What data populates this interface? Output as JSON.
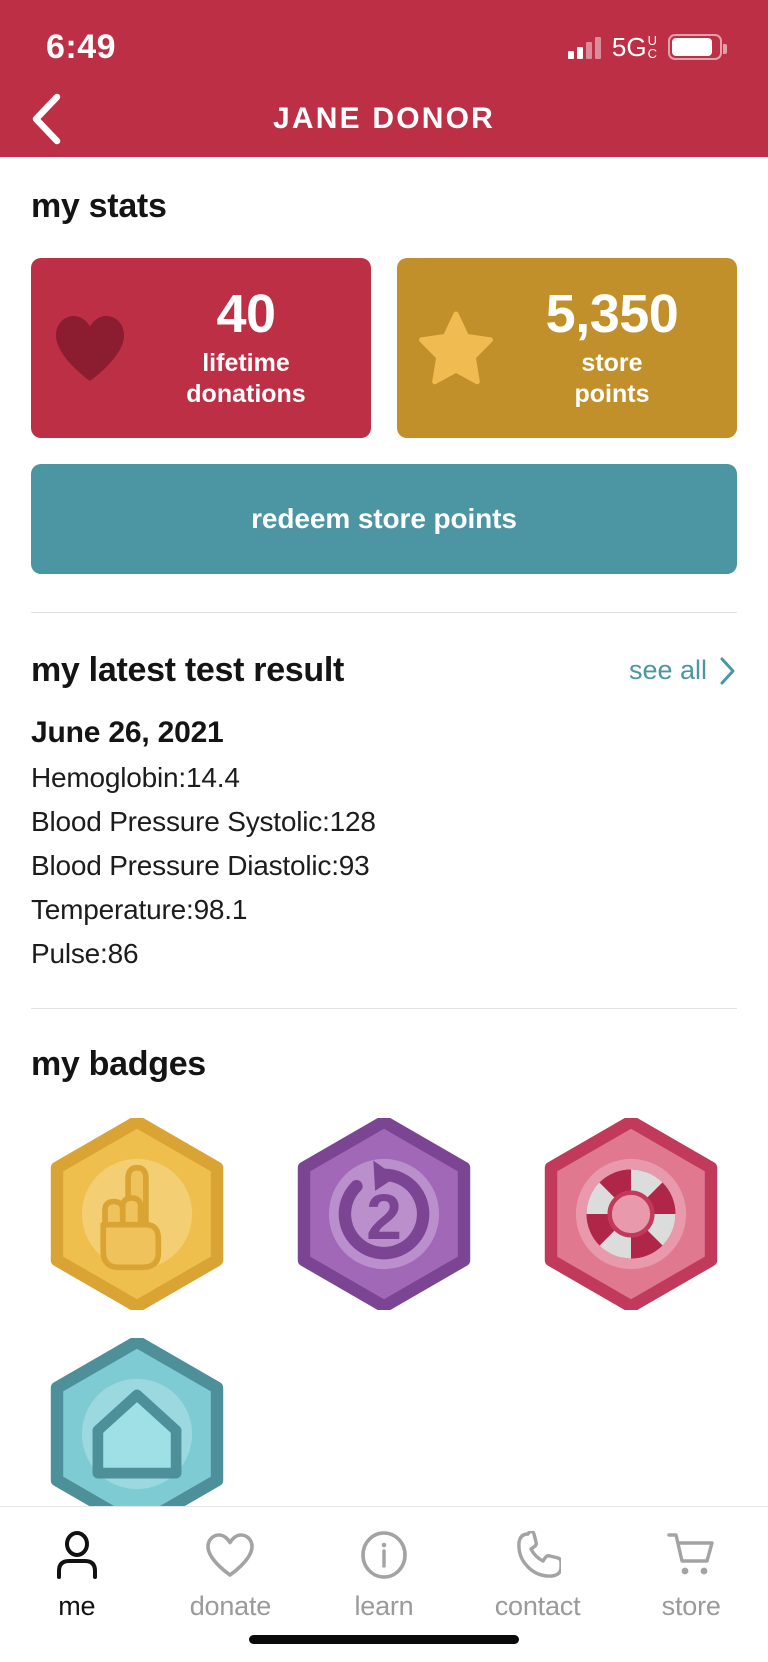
{
  "status_bar": {
    "time": "6:49",
    "network": "5G",
    "network_sub_top": "U",
    "network_sub_bottom": "C",
    "signal_icon": "signal-bars-icon",
    "battery_icon": "battery-icon"
  },
  "header": {
    "title": "JANE DONOR",
    "back_icon": "back-chevron-icon",
    "background_color": "#BC2F45"
  },
  "stats": {
    "section_title": "my stats",
    "cards": [
      {
        "icon": "heart-icon",
        "value": "40",
        "label": "lifetime\ndonations",
        "label_line1": "lifetime",
        "label_line2": "donations",
        "color": "#BC2F45"
      },
      {
        "icon": "star-icon",
        "value": "5,350",
        "label": "store\npoints",
        "label_line1": "store",
        "label_line2": "points",
        "color": "#C1902B"
      }
    ],
    "redeem_button": {
      "label": "redeem store points",
      "color": "#4C96A3"
    }
  },
  "test_result": {
    "section_title": "my latest test result",
    "see_all_label": "see all",
    "see_all_icon": "chevron-right-icon",
    "see_all_color": "#4C96A3",
    "date": "June 26, 2021",
    "measurements": [
      "Hemoglobin:14.4",
      "Blood Pressure Systolic:128",
      "Blood Pressure Diastolic:93",
      "Temperature:98.1",
      "Pulse:86"
    ]
  },
  "badges": {
    "section_title": "my badges",
    "items": [
      {
        "name": "first-donation-badge",
        "icon": "pointing-finger-icon",
        "color": "#EFBF4E",
        "label": ""
      },
      {
        "name": "second-donation-badge",
        "icon": "repeat-two-icon",
        "color": "#9B5FB0",
        "label": "2"
      },
      {
        "name": "lifesaver-badge",
        "icon": "life-preserver-icon",
        "color": "#D4536E",
        "label": ""
      },
      {
        "name": "home-badge",
        "icon": "house-icon",
        "color": "#7FCBD4",
        "label": ""
      }
    ]
  },
  "tabbar": {
    "items": [
      {
        "label": "me",
        "icon": "person-icon",
        "active": true
      },
      {
        "label": "donate",
        "icon": "heart-outline-icon",
        "active": false
      },
      {
        "label": "learn",
        "icon": "info-circle-icon",
        "active": false
      },
      {
        "label": "contact",
        "icon": "phone-icon",
        "active": false
      },
      {
        "label": "store",
        "icon": "shopping-cart-icon",
        "active": false
      }
    ],
    "active_color": "#111111",
    "inactive_color": "#9A9A9A"
  }
}
